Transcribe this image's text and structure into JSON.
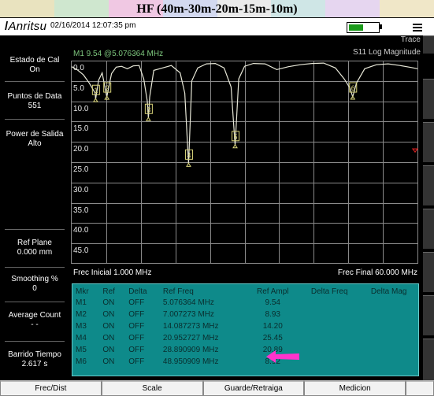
{
  "title": "HF (40m-30m-20m-15m-10m)",
  "header": {
    "brand": "Anritsu",
    "datetime": "02/16/2014 12:07:35 pm"
  },
  "left_panel": [
    {
      "label": "Estado de Cal",
      "value": "On"
    },
    {
      "label": "Puntos de Data",
      "value": "551"
    },
    {
      "label": "Power de Salida",
      "value": "Alto"
    },
    {
      "label": "Ref Plane",
      "value": "0.000 mm"
    },
    {
      "label": "Smoothing %",
      "value": "0"
    },
    {
      "label": "Average Count",
      "value": "- -"
    },
    {
      "label": "Barrido Tiempo",
      "value": "2.617 s"
    }
  ],
  "chart": {
    "trace_label": "Trace",
    "measurement": "S11 Log Magnitude",
    "marker_readout": "M1  9.54 @5.076364 MHz",
    "freq_start": "Frec Inicial 1.000 MHz",
    "freq_stop": "Frec Final 60.000 MHz"
  },
  "chart_data": {
    "type": "line",
    "y_ticks": [
      "0.0",
      "5.0",
      "10.0",
      "15.0",
      "20.0",
      "25.0",
      "30.0",
      "35.0",
      "40.0",
      "45.0"
    ],
    "ylim": [
      0,
      50
    ],
    "xlim": [
      1.0,
      60.0
    ],
    "series": [
      {
        "x": [
          1.0,
          2.0,
          3.0,
          4.0,
          5.0,
          5.08,
          5.6,
          6.2,
          7.0,
          7.8,
          8.6,
          9.5,
          10.5,
          11.5,
          12.5,
          13.3,
          13.9,
          14.09,
          14.3,
          15.0,
          16.5,
          18.0,
          19.5,
          20.3,
          20.95,
          21.5,
          22.5,
          24.0,
          25.5,
          27.0,
          28.2,
          28.89,
          29.5,
          30.5,
          32.0,
          34.0,
          36.0,
          38.0,
          40.0,
          42.0,
          44.0,
          46.0,
          47.5,
          48.5,
          48.95,
          49.6,
          51.0,
          53.0,
          55.0,
          57.0,
          59.0,
          60.0
        ],
        "y": [
          1.5,
          2.3,
          3.5,
          5.5,
          8.0,
          9.54,
          4.8,
          3.0,
          8.93,
          3.2,
          1.6,
          1.4,
          2.0,
          1.3,
          1.2,
          4.5,
          10.0,
          14.2,
          9.0,
          2.4,
          1.8,
          1.2,
          3.0,
          8.0,
          25.45,
          5.0,
          1.8,
          0.8,
          0.7,
          1.8,
          6.5,
          20.89,
          4.5,
          1.4,
          0.7,
          0.8,
          2.2,
          1.5,
          1.0,
          0.7,
          0.6,
          1.8,
          4.5,
          6.8,
          8.92,
          5.5,
          2.0,
          1.0,
          0.8,
          1.2,
          1.7,
          2.0
        ]
      }
    ],
    "markers": [
      {
        "label": "1",
        "x": 5.076364,
        "y": 9.54
      },
      {
        "label": "2",
        "x": 7.007273,
        "y": 8.93
      },
      {
        "label": "3",
        "x": 14.087273,
        "y": 14.2
      },
      {
        "label": "4",
        "x": 20.952727,
        "y": 25.45
      },
      {
        "label": "5",
        "x": 28.890909,
        "y": 20.89
      },
      {
        "label": "6",
        "x": 48.950909,
        "y": 8.92
      }
    ]
  },
  "marker_table": {
    "headers": [
      "Mkr",
      "Ref",
      "Delta",
      "Ref Freq",
      "Ref Ampl",
      "Delta Freq",
      "Delta Mag"
    ],
    "rows": [
      [
        "M1",
        "ON",
        "OFF",
        "5.076364 MHz",
        "9.54"
      ],
      [
        "M2",
        "ON",
        "OFF",
        "7.007273 MHz",
        "8.93"
      ],
      [
        "M3",
        "ON",
        "OFF",
        "14.087273 MHz",
        "14.20"
      ],
      [
        "M4",
        "ON",
        "OFF",
        "20.952727 MHz",
        "25.45"
      ],
      [
        "M5",
        "ON",
        "OFF",
        "28.890909 MHz",
        "20.89"
      ],
      [
        "M6",
        "ON",
        "OFF",
        "48.950909 MHz",
        "8.92"
      ]
    ]
  },
  "softkeys": [
    "Frec/Dist",
    "Scale",
    "Guarde/Retraiga",
    "Medicion"
  ],
  "colors": {
    "trace": "#e8e8d8",
    "grid": "#8a8a8a",
    "marker_box": "#d9d47a",
    "table_bg": "#0e8a8a",
    "arrow": "#ff33cc",
    "reference_marker": "#d02020"
  }
}
